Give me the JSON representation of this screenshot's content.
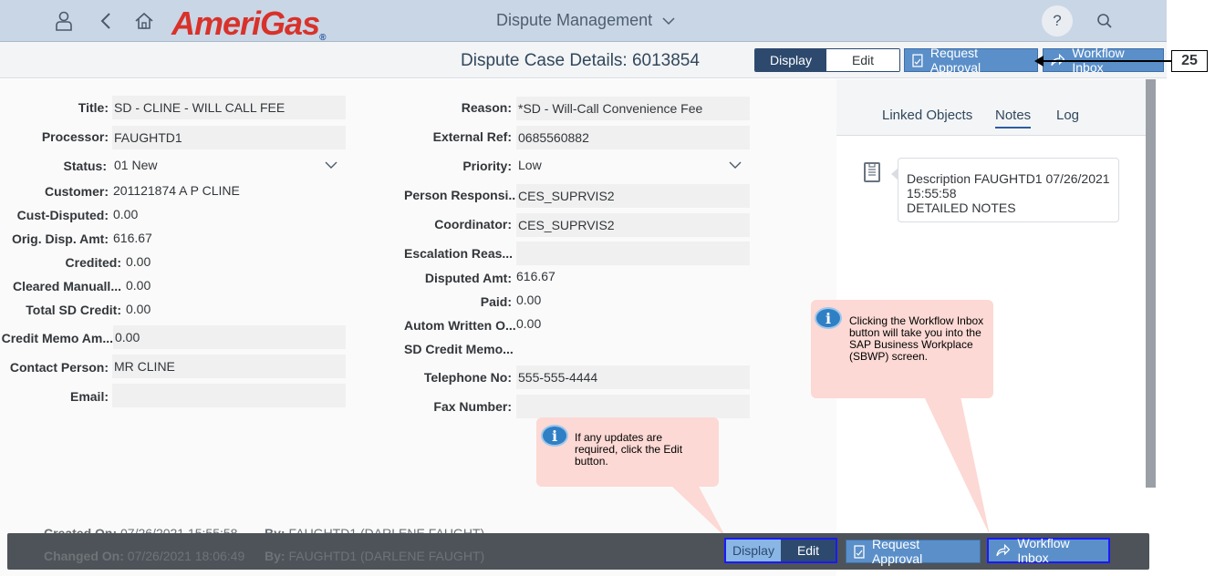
{
  "shell": {
    "title": "Dispute Management",
    "logo_text": "AmeriGas",
    "logo_reg": "®",
    "help": "?"
  },
  "header": {
    "page_title": "Dispute Case Details: 6013854",
    "display_label": "Display",
    "edit_label": "Edit",
    "request_approval_label": "Request Approval",
    "workflow_inbox_label": "Workflow Inbox",
    "step_number": "25"
  },
  "form_left": [
    {
      "label": "Title:",
      "value": "SD - CLINE - WILL CALL FEE"
    },
    {
      "label": "Processor:",
      "value": "FAUGHTD1"
    },
    {
      "label": "Status:",
      "value": "01 New"
    },
    {
      "label": "Customer:",
      "value": "201121874 A P CLINE"
    },
    {
      "label": "Cust-Disputed:",
      "value": "0.00"
    },
    {
      "label": "Orig. Disp. Amt:",
      "value": "616.67"
    },
    {
      "label": "Credited:",
      "value": "0.00"
    },
    {
      "label": "Cleared Manuall...",
      "value": "0.00"
    },
    {
      "label": "Total SD Credit:",
      "value": "0.00"
    },
    {
      "label": "Credit Memo Am...",
      "value": "0.00"
    },
    {
      "label": "Contact Person:",
      "value": "MR CLINE"
    },
    {
      "label": "Email:",
      "value": ""
    }
  ],
  "form_right": [
    {
      "label": "Reason:",
      "value": "*SD - Will-Call Convenience Fee"
    },
    {
      "label": "External Ref:",
      "value": "0685560882"
    },
    {
      "label": "Priority:",
      "value": "Low"
    },
    {
      "label": "Person Responsi...",
      "value": "CES_SUPRVIS2"
    },
    {
      "label": "Coordinator:",
      "value": "CES_SUPRVIS2"
    },
    {
      "label": "Escalation Reas...",
      "value": ""
    },
    {
      "label": "Disputed Amt:",
      "value": "616.67"
    },
    {
      "label": "Paid:",
      "value": "0.00"
    },
    {
      "label": "Autom Written O...",
      "value": "0.00"
    },
    {
      "label": "SD Credit Memo...",
      "value": ""
    },
    {
      "label": "Telephone No:",
      "value": "555-555-4444"
    },
    {
      "label": "Fax Number:",
      "value": ""
    }
  ],
  "side_panel": {
    "tabs": [
      "Linked Objects",
      "Notes",
      "Log"
    ],
    "note_line1": "Description FAUGHTD1 07/26/2021",
    "note_line2": "15:55:58",
    "note_line3": "DETAILED NOTES"
  },
  "tooltips": {
    "workflow": "Clicking the Workflow Inbox button will take you into the SAP Business Workplace (SBWP) screen.",
    "edit": "If any updates are required, click the Edit button."
  },
  "footer": {
    "created_label": "Created On:",
    "created_value": "07/26/2021 15:55:58",
    "created_by_label": "By:",
    "created_by_value": "FAUGHTD1 (DARLENE FAUGHT)",
    "changed_label": "Changed On:",
    "changed_value": "07/26/2021 18:06:49",
    "changed_by_label": "By:",
    "changed_by_value": "FAUGHTD1 (DARLENE FAUGHT)",
    "display_label": "Display",
    "edit_label": "Edit",
    "request_approval_label": "Request Approval",
    "workflow_inbox_label": "Workflow Inbox"
  },
  "colors": {
    "shell_bg": "#c9d6e6",
    "accent": "#2d4a6e",
    "button_blue": "#5a8fc9",
    "tooltip_bg": "#fcd9d4",
    "highlight_border": "#1a1aff",
    "logo_red": "#d8322a"
  }
}
